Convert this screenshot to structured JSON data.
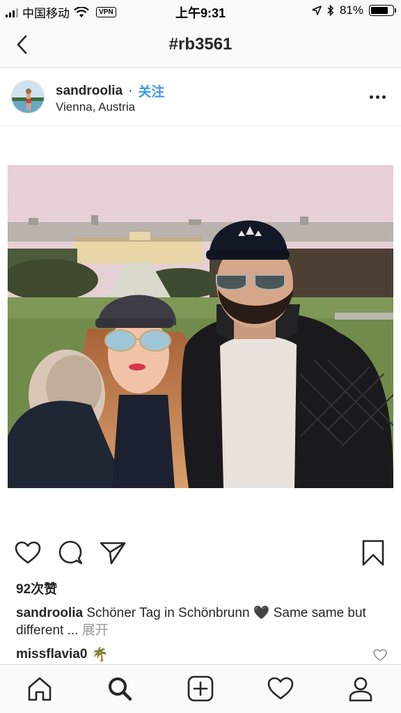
{
  "status_bar": {
    "carrier": "中国移动",
    "vpn": "VPN",
    "time": "上午9:31",
    "battery_pct": "81%",
    "battery_level": 0.81
  },
  "nav": {
    "title": "#rb3561",
    "back_icon": "chevron-left-icon"
  },
  "post": {
    "username": "sandroolia",
    "separator": "·",
    "follow_label": "关注",
    "location": "Vienna, Austria",
    "likes": "92次赞",
    "caption_user": "sandroolia",
    "caption_text": "Schöner Tag in Schönbrunn 🖤 Same same but different ...",
    "caption_more": "展开",
    "comment_user": "missflavia0",
    "comment_emoji": "🌴"
  },
  "icons": {
    "like": "heart-icon",
    "comment": "comment-icon",
    "share": "send-icon",
    "save": "bookmark-icon",
    "home": "home-icon",
    "search": "search-icon",
    "add": "add-post-icon",
    "activity": "heart-icon",
    "profile": "profile-icon"
  },
  "colors": {
    "follow": "#3897f0",
    "text": "#262626",
    "muted": "#999999"
  }
}
